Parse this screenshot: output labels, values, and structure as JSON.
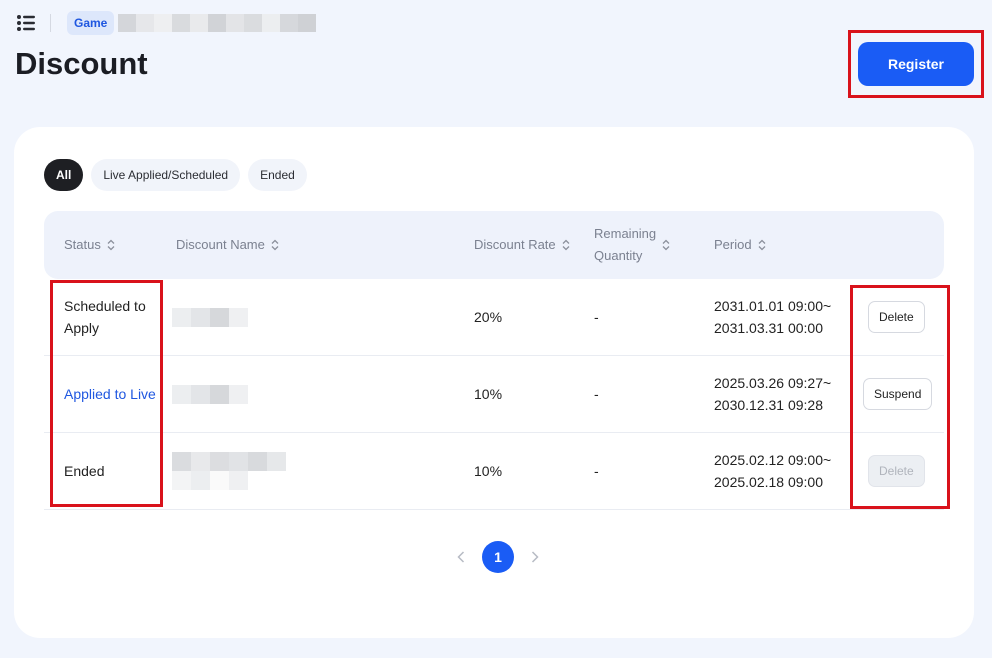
{
  "header": {
    "breadcrumb_chip": "Game",
    "page_title": "Discount",
    "register_label": "Register"
  },
  "filters": [
    {
      "label": "All",
      "active": true
    },
    {
      "label": "Live Applied/Scheduled",
      "active": false
    },
    {
      "label": "Ended",
      "active": false
    }
  ],
  "table": {
    "columns": {
      "status": "Status",
      "name": "Discount Name",
      "rate": "Discount Rate",
      "remaining_line1": "Remaining",
      "remaining_line2": "Quantity",
      "period": "Period"
    },
    "rows": [
      {
        "status_line1": "Scheduled to",
        "status_line2": "Apply",
        "rate": "20%",
        "remaining": "-",
        "period_start": "2031.01.01 09:00~",
        "period_end": "2031.03.31 00:00",
        "action": "Delete"
      },
      {
        "status_line1": "Applied to Live",
        "status_line2": "",
        "rate": "10%",
        "remaining": "-",
        "period_start": "2025.03.26 09:27~",
        "period_end": "2030.12.31 09:28",
        "action": "Suspend"
      },
      {
        "status_line1": "Ended",
        "status_line2": "",
        "rate": "10%",
        "remaining": "-",
        "period_start": "2025.02.12 09:00~",
        "period_end": "2025.02.18 09:00",
        "action": "Delete"
      }
    ]
  },
  "pagination": {
    "current": "1"
  },
  "colors": {
    "accent": "#1a5cf5",
    "highlight": "#d9121b",
    "live_status": "#1f57e0",
    "background": "#f1f5fd"
  },
  "icons": {
    "menu": "list-menu-icon",
    "sort": "sort-arrows-icon",
    "prev": "chevron-left-icon",
    "next": "chevron-right-icon"
  }
}
